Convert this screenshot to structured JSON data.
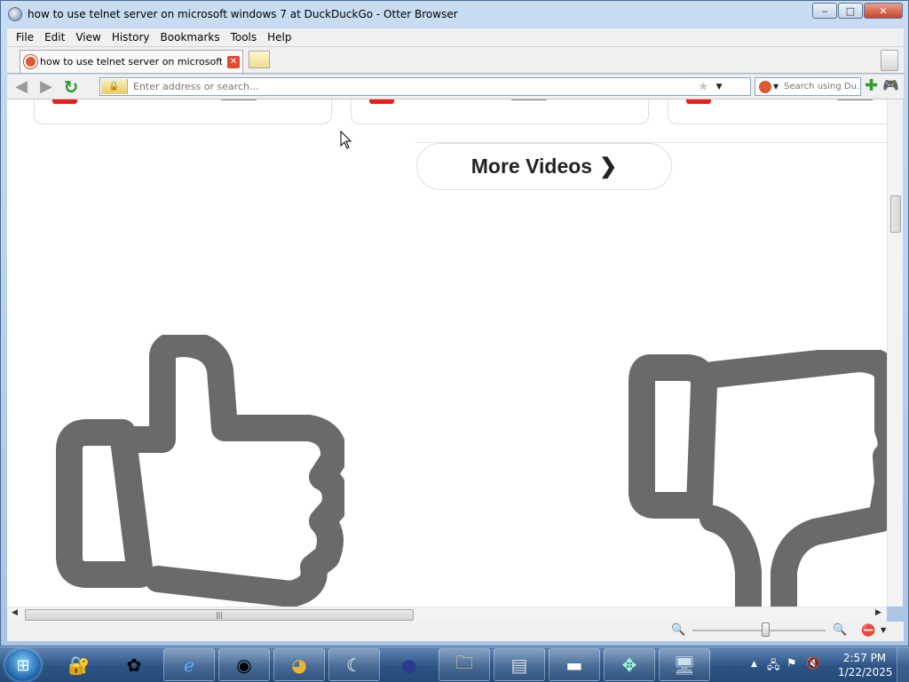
{
  "window": {
    "title": "how to use telnet server on microsoft windows 7 at DuckDuckGo - Otter Browser",
    "controls": {
      "minimize": "‒",
      "maximize": "□",
      "close": "✕"
    }
  },
  "menu": [
    "File",
    "Edit",
    "View",
    "History",
    "Bookmarks",
    "Tools",
    "Help"
  ],
  "tabs": [
    {
      "label": "how to use telnet server on microsoft wi...",
      "icon": "duckduckgo-icon",
      "active": true
    }
  ],
  "navbar": {
    "address_placeholder": "Enter address or search...",
    "address_value": "",
    "search_placeholder": "Search using Du..."
  },
  "page": {
    "more_videos_label": "More Videos",
    "chevron": "❯",
    "feedback_icons": [
      "thumbs-up-icon",
      "thumbs-down-icon"
    ]
  },
  "statusbar": {
    "zoom_level": 0.55
  },
  "taskbar": {
    "apps": [
      "security-icon",
      "pinwheel-icon",
      "internet-explorer-icon",
      "otter-browser-icon",
      "chrome-icon",
      "moon-app-icon",
      "eclipse-icon",
      "folder-icon",
      "control-panel-icon",
      "command-prompt-icon",
      "network-puzzle-icon",
      "remote-desktop-icon"
    ],
    "clock_time": "2:57 PM",
    "clock_date": "1/22/2025"
  },
  "colors": {
    "accent": "#2c5384",
    "ddg": "#de5833",
    "thumb": "#6a6a6a"
  }
}
